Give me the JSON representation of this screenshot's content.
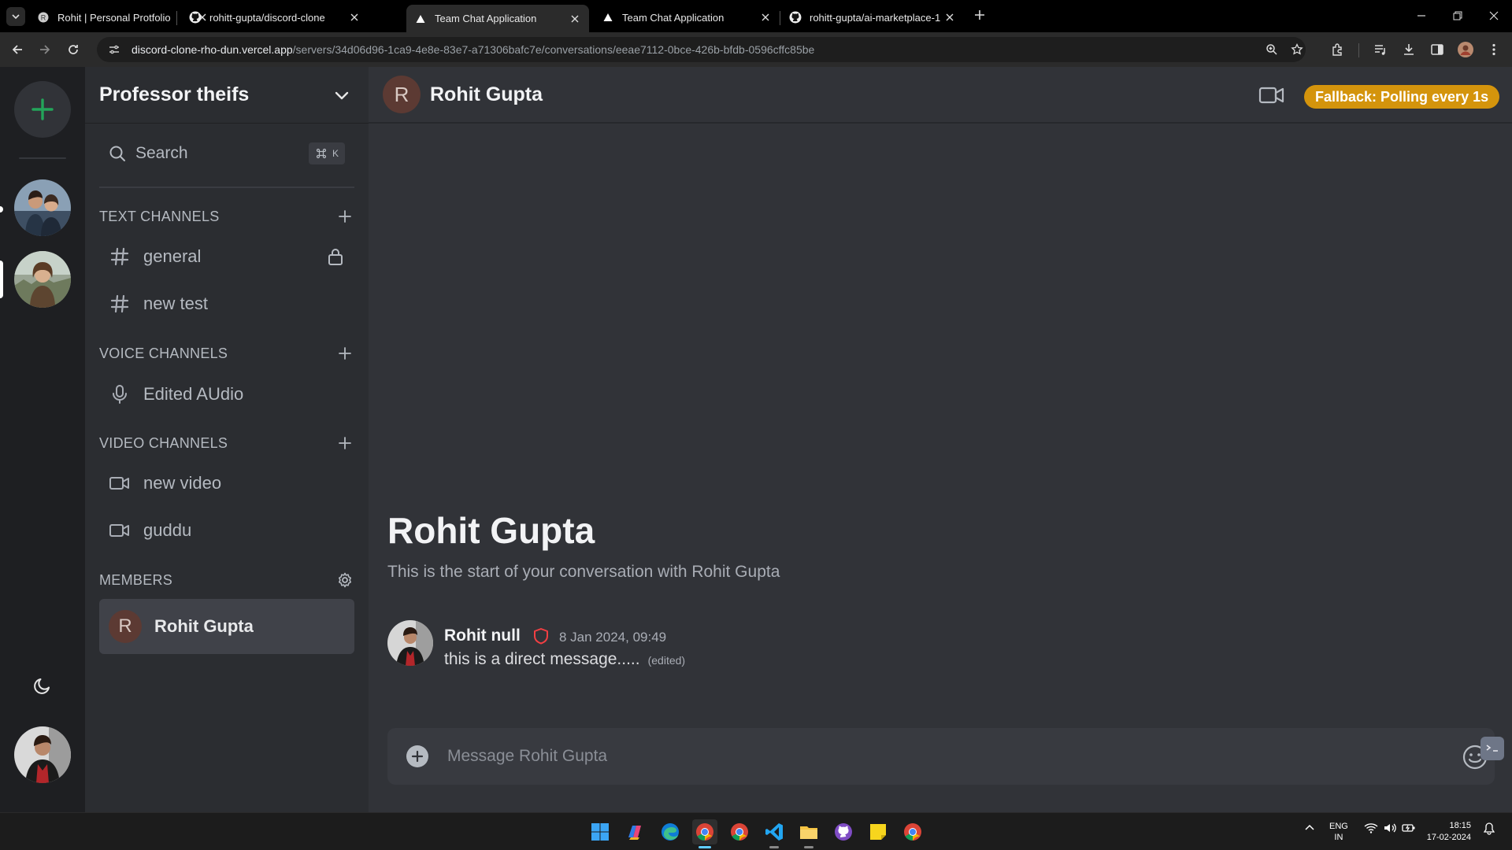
{
  "browser": {
    "tabs": [
      {
        "title": "Rohit | Personal Protfolio",
        "favicon": "r-circle-icon",
        "active": false
      },
      {
        "title": "rohitt-gupta/discord-clone",
        "favicon": "github-icon",
        "active": false
      },
      {
        "title": "Team Chat Application",
        "favicon": "vercel-triangle-icon",
        "active": true
      },
      {
        "title": "Team Chat Application",
        "favicon": "vercel-triangle-icon",
        "active": false
      },
      {
        "title": "rohitt-gupta/ai-marketplace-1",
        "favicon": "github-icon",
        "active": false
      }
    ],
    "url_host": "discord-clone-rho-dun.vercel.app",
    "url_path": "/servers/34d06d96-1ca9-4e8e-83e7-a71306bafc7e/conversations/eeae7112-0bce-426b-bfdb-0596cffc85be"
  },
  "server_rail": {
    "servers": [
      "group-photo-server",
      "portrait-server"
    ],
    "selected_index": 1
  },
  "sidebar": {
    "server_name": "Professor theifs",
    "search_label": "Search",
    "search_shortcut_key": "K",
    "text_channels": {
      "title": "TEXT CHANNELS",
      "items": [
        {
          "name": "general",
          "icon": "hash-icon",
          "locked": true
        },
        {
          "name": "new test",
          "icon": "hash-icon",
          "locked": false
        }
      ]
    },
    "voice_channels": {
      "title": "VOICE CHANNELS",
      "items": [
        {
          "name": "Edited AUdio",
          "icon": "mic-icon"
        }
      ]
    },
    "video_channels": {
      "title": "VIDEO CHANNELS",
      "items": [
        {
          "name": "new video",
          "icon": "video-icon"
        },
        {
          "name": "guddu",
          "icon": "video-icon"
        }
      ]
    },
    "members": {
      "title": "MEMBERS",
      "items": [
        {
          "initial": "R",
          "name": "Rohit Gupta"
        }
      ]
    }
  },
  "chat": {
    "header": {
      "initial": "R",
      "title": "Rohit Gupta",
      "status": "Fallback: Polling every 1s"
    },
    "welcome": {
      "title": "Rohit Gupta",
      "subtitle": "This is the start of your conversation with Rohit Gupta"
    },
    "messages": [
      {
        "author": "Rohit null",
        "role_icon": "shield-icon",
        "timestamp": "8 Jan 2024, 09:49",
        "content": "this is a direct message.....",
        "edited": "(edited)"
      }
    ],
    "composer": {
      "placeholder": "Message Rohit Gupta"
    }
  },
  "taskbar": {
    "language": "ENG",
    "region": "IN",
    "time": "18:15",
    "date": "17-02-2024"
  },
  "colors": {
    "accent_green": "#23a55a",
    "status_pill": "#d4940c",
    "shield_red": "#f23f43",
    "member_avatar": "#5c3a33"
  }
}
